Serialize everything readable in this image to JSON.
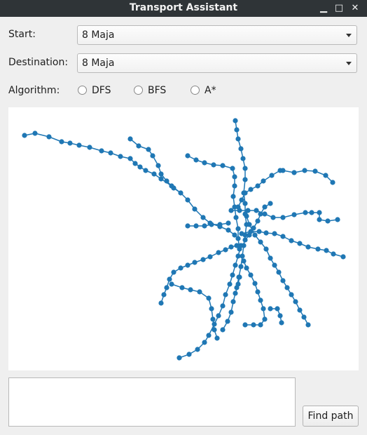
{
  "window": {
    "title": "Transport Assistant",
    "controls": {
      "minimize": "▁",
      "maximize": "□",
      "close": "✕"
    }
  },
  "form": {
    "start_label": "Start:",
    "start_value": "8 Maja",
    "destination_label": "Destination:",
    "destination_value": "8 Maja",
    "algorithm_label": "Algorithm:",
    "algorithms": [
      "DFS",
      "BFS",
      "A*"
    ],
    "selected_algorithm": null
  },
  "output": {
    "text": ""
  },
  "find_button": "Find path",
  "colors": {
    "accent": "#1f77b4",
    "titlebar": "#2f3437",
    "background": "#efefef"
  }
}
